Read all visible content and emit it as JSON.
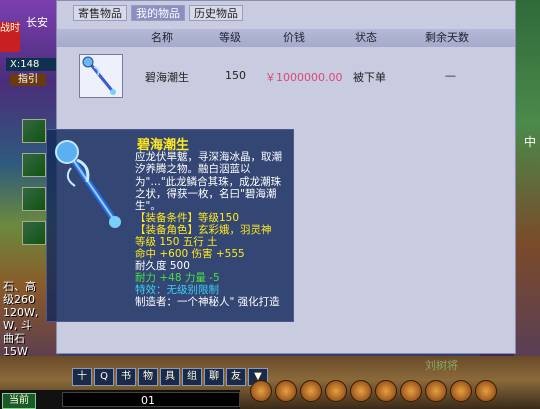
{
  "game_ui": {
    "city": "长安",
    "coord": "X:148",
    "guide": "指引",
    "side_tag": "战时",
    "left_stats": [
      "石、高",
      "级260",
      "120W,",
      "W, 斗",
      "曲石",
      "15W"
    ],
    "right_label": "中",
    "bottom_name": "刘树将",
    "chat_button": "当前",
    "chat_value": "01",
    "bottom_icons": [
      "十",
      "Q",
      "书",
      "物",
      "具",
      "组",
      "聊",
      "友",
      "▼"
    ]
  },
  "window": {
    "tabs": [
      {
        "label": "寄售物品",
        "active": false
      },
      {
        "label": "我的物品",
        "active": true
      },
      {
        "label": "历史物品",
        "active": false
      }
    ],
    "columns": [
      "名称",
      "等级",
      "价钱",
      "状态",
      "剩余天数"
    ],
    "rows": [
      {
        "name": "碧海潮生",
        "level": "150",
        "price": "￥1000000.00",
        "status": "被下单",
        "days": "—"
      }
    ]
  },
  "tooltip": {
    "title": "碧海潮生",
    "description": "应龙伏旱魃，寻深海冰晶，取潮汐养腾之物。融白洇蓝以为\"…\"此龙鳞合其珠，成龙潮珠之状，得获一枚，名曰\"碧海潮生\"。",
    "requirement_label": "【装备条件】等级150",
    "role_label": "【装备角色】玄彩娥，羽灵神",
    "level_line": "等级 150  五行 土",
    "hit_line": "命中 +600 伤害 +555",
    "durability": "耐久度 500",
    "bonus_line": "耐力 +48 力量 -5",
    "special": "特效：无级别限制",
    "maker": "制造者：一个神秘人\" 强化打造"
  },
  "colors": {
    "window_bg": "#c9cbe0",
    "header_bg": "#a6aacc",
    "tab_active": "#8a8ec0",
    "price": "#d84a7a",
    "tooltip_bg": "#14285a",
    "tip_yellow": "#ffea20",
    "tip_green": "#48e048",
    "tip_cyan": "#3ad0f0"
  },
  "icons": [
    "staff-item-icon",
    "staff-large-icon"
  ]
}
